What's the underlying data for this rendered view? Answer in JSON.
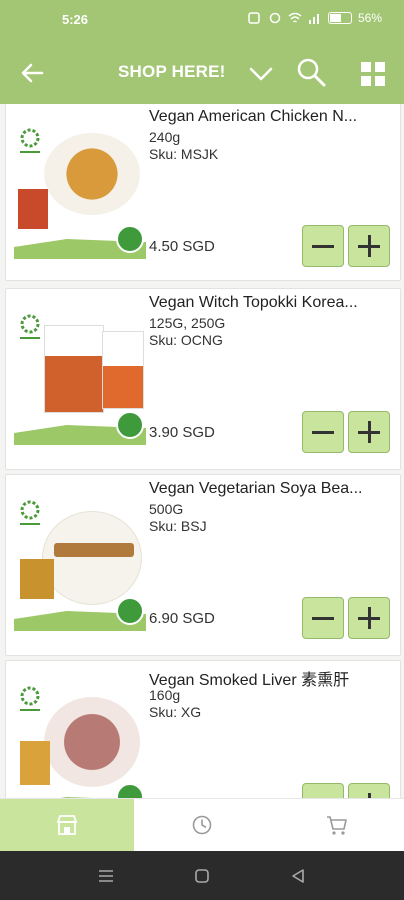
{
  "status_bar": {
    "time": "5:26",
    "battery": "56%"
  },
  "header": {
    "title": "SHOP HERE!"
  },
  "products": [
    {
      "name": "Vegan American Chicken N...",
      "weight": "240g",
      "sku": "Sku: MSJK",
      "price": "4.50 SGD"
    },
    {
      "name": "Vegan Witch Topokki Korea...",
      "weight": "125G, 250G",
      "sku": "Sku: OCNG",
      "price": "3.90 SGD"
    },
    {
      "name": "Vegan Vegetarian Soya Bea...",
      "weight": "500G",
      "sku": "Sku: BSJ",
      "price": "6.90 SGD"
    },
    {
      "name": "Vegan Smoked Liver  素熏肝",
      "weight": "160g",
      "sku": "Sku: XG",
      "price": ""
    }
  ],
  "tabs": [
    {
      "icon": "shop-icon",
      "active": true
    },
    {
      "icon": "clock-icon",
      "active": false
    },
    {
      "icon": "cart-icon",
      "active": false
    }
  ],
  "colors": {
    "accent": "#a3c675",
    "button": "#c9e59d",
    "badge": "#3f9a3c"
  }
}
